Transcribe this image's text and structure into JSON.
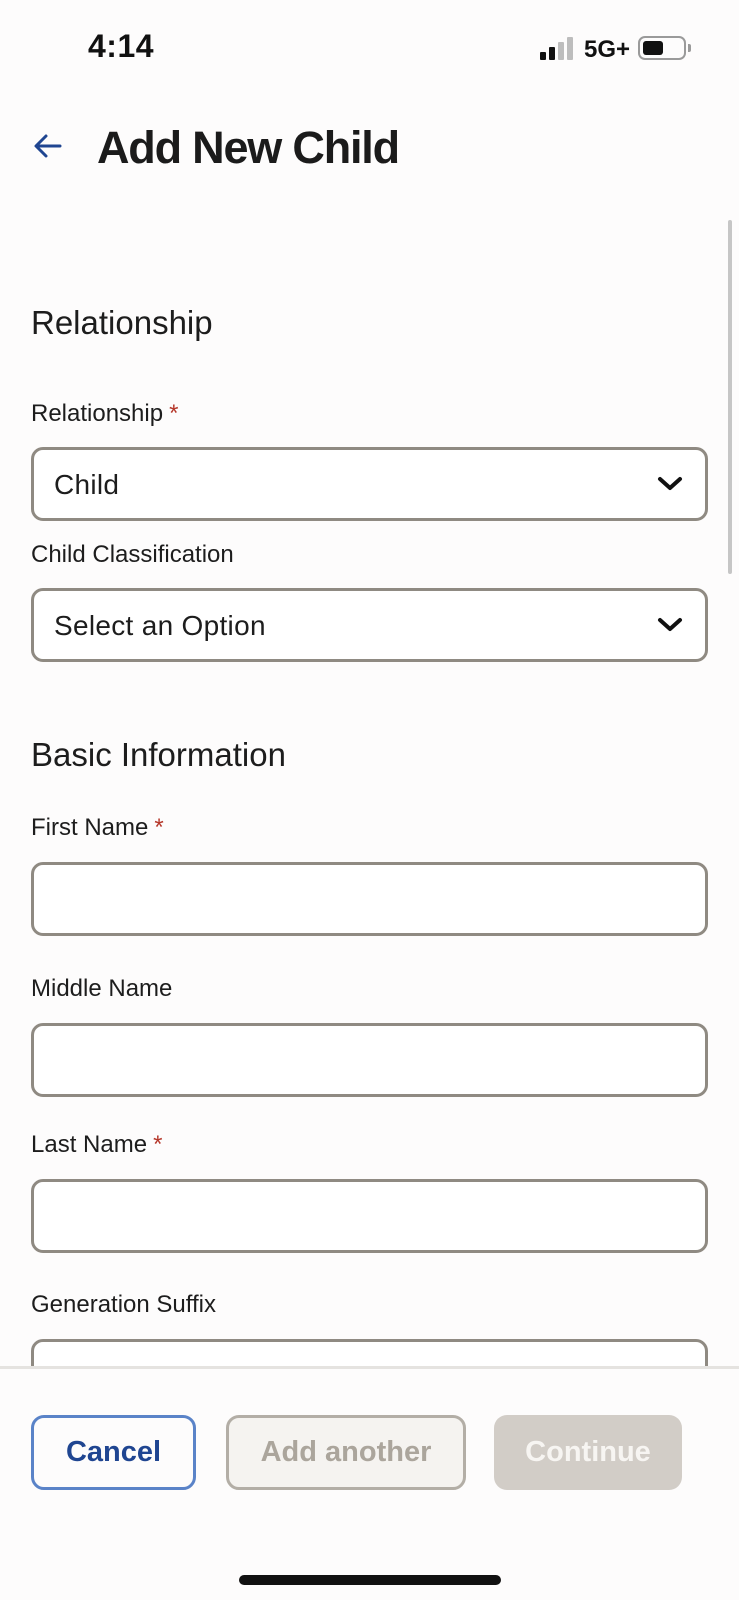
{
  "status_bar": {
    "time": "4:14",
    "network": "5G+",
    "signal_bars_filled": 2,
    "signal_bars_total": 4,
    "battery_level": 0.45
  },
  "header": {
    "title": "Add New Child",
    "back_icon": "arrow-left-icon"
  },
  "relationship_section": {
    "heading": "Relationship",
    "relationship": {
      "label": "Relationship",
      "required_mark": "*",
      "value": "Child"
    },
    "classification": {
      "label": "Child Classification",
      "value": "Select an Option"
    }
  },
  "basic_info_section": {
    "heading": "Basic Information",
    "first_name": {
      "label": "First Name",
      "required_mark": "*",
      "value": ""
    },
    "middle_name": {
      "label": "Middle Name",
      "value": ""
    },
    "last_name": {
      "label": "Last Name",
      "required_mark": "*",
      "value": ""
    },
    "generation_suffix": {
      "label": "Generation Suffix"
    }
  },
  "footer": {
    "cancel_label": "Cancel",
    "add_another_label": "Add another",
    "continue_label": "Continue"
  },
  "colors": {
    "title": "#1b1b1b",
    "required": "#b5372a",
    "field_border": "#8f8a82",
    "cancel_border": "#5a83c8",
    "cancel_text": "#1f4591",
    "disabled_fill": "#d2cdc7",
    "back_arrow": "#1f4591"
  }
}
